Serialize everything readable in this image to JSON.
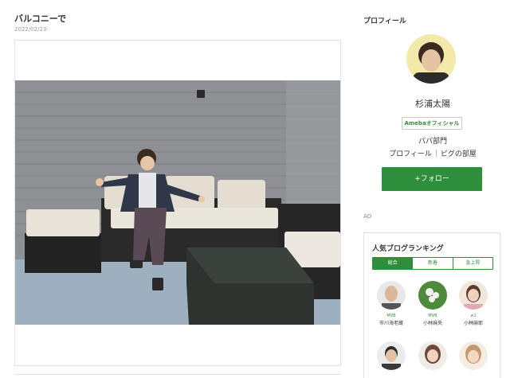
{
  "post": {
    "title": "バルコニーで",
    "date": "2022/02/23"
  },
  "sidebar": {
    "heading": "プロフィール",
    "name": "杉浦太陽",
    "badge": "Amebaオフィシャル",
    "genre": "パパ部門",
    "links": [
      "プロフィール",
      "ピグの部屋"
    ],
    "follow_label": "+フォロー",
    "ad_label": "AD"
  },
  "ranking": {
    "title": "人気ブログランキング",
    "tabs": [
      "総合",
      "新着",
      "急上昇"
    ],
    "active_tab": 0,
    "items": [
      {
        "meta": "MVB",
        "name": "市川海老蔵"
      },
      {
        "meta": "MVB",
        "name": "小林麻央"
      },
      {
        "meta": "w1",
        "name": "小林麻耶"
      },
      {
        "meta": "",
        "name": ""
      },
      {
        "meta": "",
        "name": ""
      },
      {
        "meta": "",
        "name": ""
      }
    ]
  },
  "colors": {
    "accent_green": "#2d8f3b",
    "border_gray": "#e2e2e2"
  }
}
